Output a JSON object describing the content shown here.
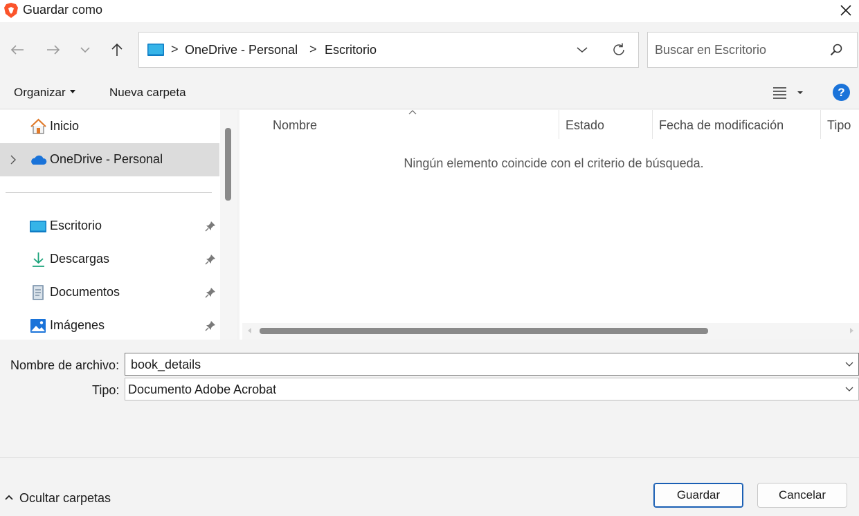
{
  "window": {
    "title": "Guardar como"
  },
  "navigation": {
    "back_icon": "arrow-left-icon",
    "forward_icon": "arrow-right-icon",
    "recent_icon": "chevron-down-icon",
    "up_icon": "arrow-up-icon"
  },
  "address": {
    "crumbs": [
      "OneDrive - Personal",
      "Escritorio"
    ],
    "separator": ">"
  },
  "search": {
    "placeholder": "Buscar en Escritorio"
  },
  "toolbar": {
    "organize_label": "Organizar",
    "new_folder_label": "Nueva carpeta",
    "help_label": "?"
  },
  "sidebar": {
    "items": [
      {
        "label": "Inicio",
        "icon": "home-icon"
      },
      {
        "label": "OneDrive - Personal",
        "icon": "cloud-icon",
        "selected": true
      },
      {
        "label": "Escritorio",
        "icon": "desktop-folder-icon",
        "pinned": true
      },
      {
        "label": "Descargas",
        "icon": "download-icon",
        "pinned": true
      },
      {
        "label": "Documentos",
        "icon": "document-icon",
        "pinned": true
      },
      {
        "label": "Imágenes",
        "icon": "image-icon",
        "pinned": true
      }
    ]
  },
  "file_list": {
    "columns": [
      "Nombre",
      "Estado",
      "Fecha de modificación",
      "Tipo"
    ],
    "empty_message": "Ningún elemento coincide con el criterio de búsqueda."
  },
  "form": {
    "filename_label": "Nombre de archivo:",
    "filename_value": "book_details",
    "type_label": "Tipo:",
    "type_value": "Documento Adobe Acrobat"
  },
  "footer": {
    "hide_folders_label": "Ocultar carpetas",
    "save_label": "Guardar",
    "cancel_label": "Cancelar"
  },
  "colors": {
    "accent": "#1a73d9",
    "selected_bg": "#dcdcdc",
    "brave_orange": "#fb542b"
  }
}
